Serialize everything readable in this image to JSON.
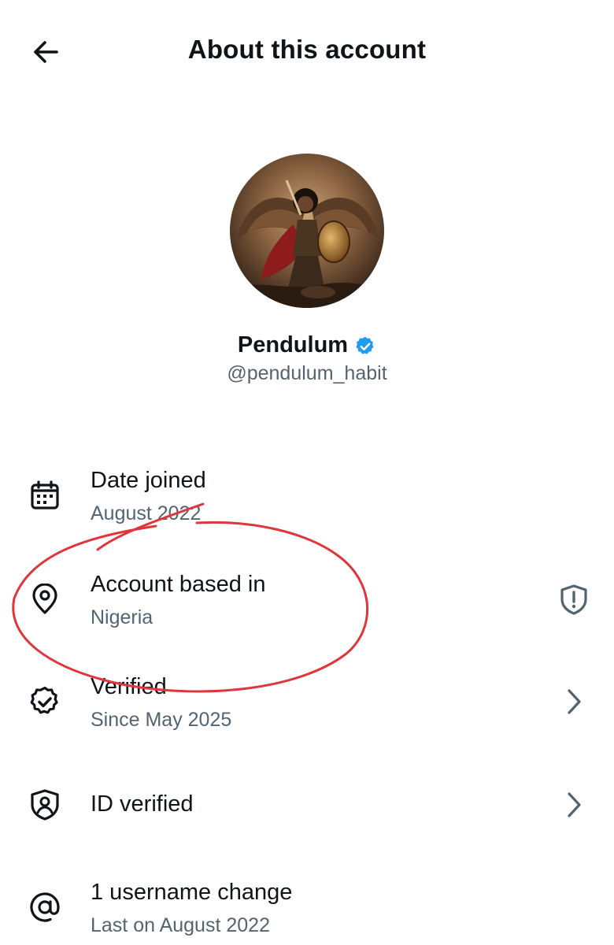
{
  "header": {
    "title": "About this account",
    "back_icon": "arrow-left-icon"
  },
  "profile": {
    "name": "Pendulum",
    "handle": "@pendulum_habit",
    "verified_badge_color": "#1d9bf0",
    "avatar": "profile-avatar-image"
  },
  "rows": [
    {
      "icon": "calendar-icon",
      "title": "Date joined",
      "subtitle": "August 2022",
      "trailing": ""
    },
    {
      "icon": "location-pin-icon",
      "title": "Account based in",
      "subtitle": "Nigeria",
      "trailing": "shield-alert-icon"
    },
    {
      "icon": "verified-check-icon",
      "title": "Verified",
      "subtitle": "Since May 2025",
      "trailing": "chevron-right-icon"
    },
    {
      "icon": "id-shield-icon",
      "title": "ID verified",
      "subtitle": "",
      "trailing": "chevron-right-icon"
    },
    {
      "icon": "at-sign-icon",
      "title": "1 username change",
      "subtitle": "Last on August 2022",
      "trailing": ""
    }
  ],
  "colors": {
    "text_primary": "#0f1419",
    "text_secondary": "#536471",
    "annotation_red": "#e0353a"
  }
}
